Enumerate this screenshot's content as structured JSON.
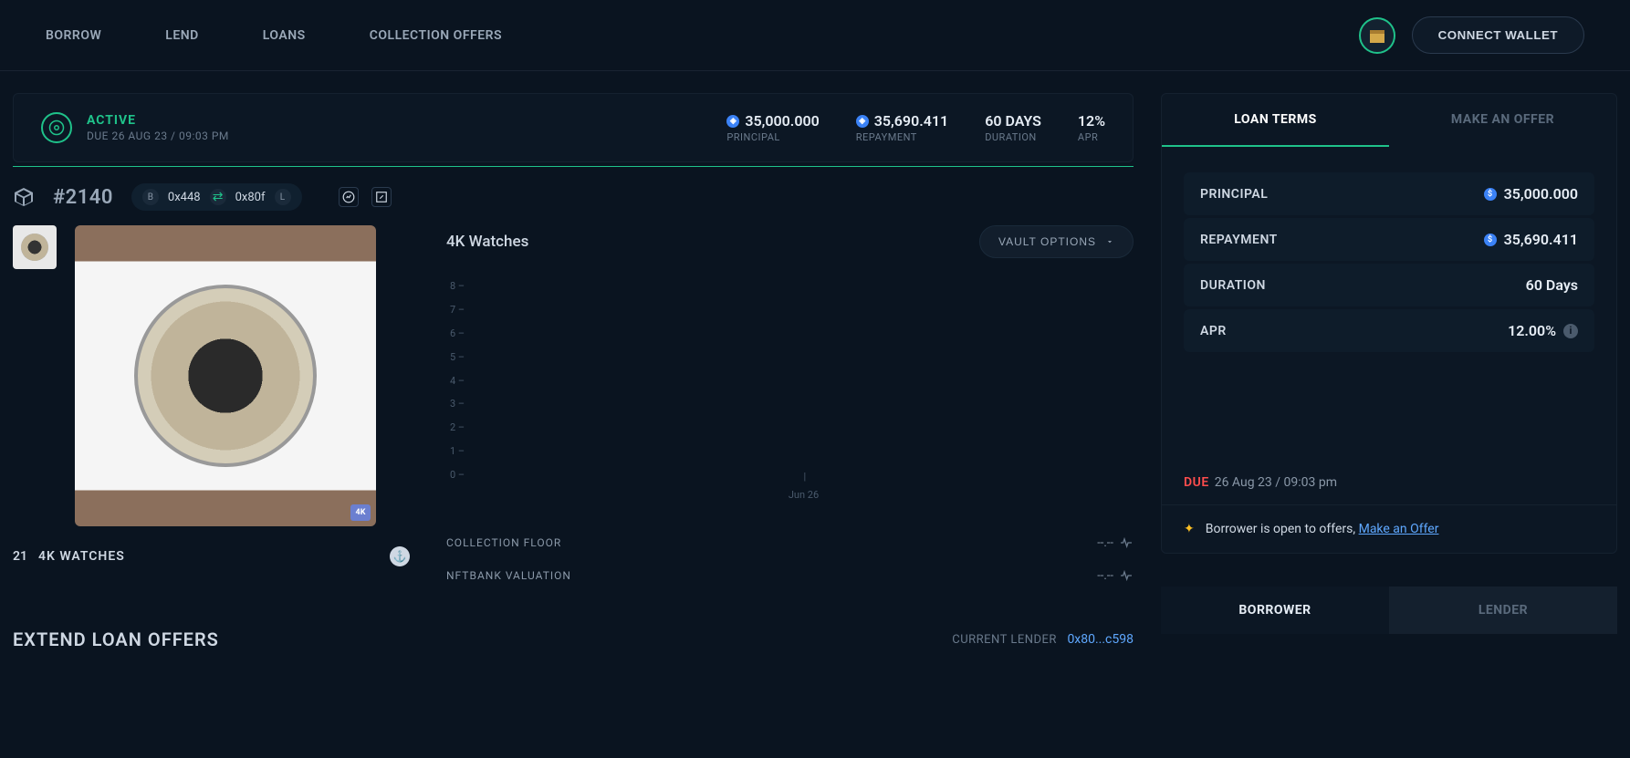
{
  "nav": {
    "borrow": "BORROW",
    "lend": "LEND",
    "loans": "LOANS",
    "collection_offers": "COLLECTION OFFERS"
  },
  "connect": "CONNECT WALLET",
  "status": {
    "label": "ACTIVE",
    "due": "DUE 26 AUG 23 / 09:03 PM",
    "principal": {
      "val": "35,000.000",
      "cap": "PRINCIPAL"
    },
    "repayment": {
      "val": "35,690.411",
      "cap": "REPAYMENT"
    },
    "duration": {
      "val": "60 DAYS",
      "cap": "DURATION"
    },
    "apr": {
      "val": "12%",
      "cap": "APR"
    }
  },
  "asset": {
    "id": "#2140",
    "borrower_addr": "0x448",
    "lender_addr": "0x80f",
    "b": "B",
    "l": "L",
    "count": "21",
    "title": "4K WATCHES",
    "badge": "4K"
  },
  "chart": {
    "title": "4K Watches",
    "vault_btn": "VAULT OPTIONS",
    "xlabel": "Jun 26"
  },
  "chart_data": {
    "type": "line",
    "title": "4K Watches",
    "x": [
      "Jun 26"
    ],
    "series": [],
    "ylim": [
      0,
      8
    ],
    "yticks": [
      8,
      7,
      6,
      5,
      4,
      3,
      2,
      1,
      0
    ],
    "xlabel": "",
    "ylabel": ""
  },
  "valuations": {
    "floor": {
      "k": "COLLECTION FLOOR",
      "v": "--.--"
    },
    "nftbank": {
      "k": "NFTBANK VALUATION",
      "v": "--.--"
    }
  },
  "terms_panel": {
    "tab_loan": "LOAN TERMS",
    "tab_offer": "MAKE AN OFFER",
    "rows": {
      "principal": {
        "k": "PRINCIPAL",
        "v": "35,000.000"
      },
      "repayment": {
        "k": "REPAYMENT",
        "v": "35,690.411"
      },
      "duration": {
        "k": "DURATION",
        "v": "60 Days"
      },
      "apr": {
        "k": "APR",
        "v": "12.00%"
      }
    },
    "due_label": "DUE",
    "due_value": "26 Aug 23 / 09:03 pm",
    "offer_note_pre": "Borrower is open to offers, ",
    "offer_note_link": "Make an Offer"
  },
  "extend": {
    "title": "EXTEND LOAN OFFERS",
    "lender_lbl": "CURRENT LENDER",
    "lender_addr": "0x80...c598"
  },
  "bl_tabs": {
    "borrower": "BORROWER",
    "lender": "LENDER"
  }
}
